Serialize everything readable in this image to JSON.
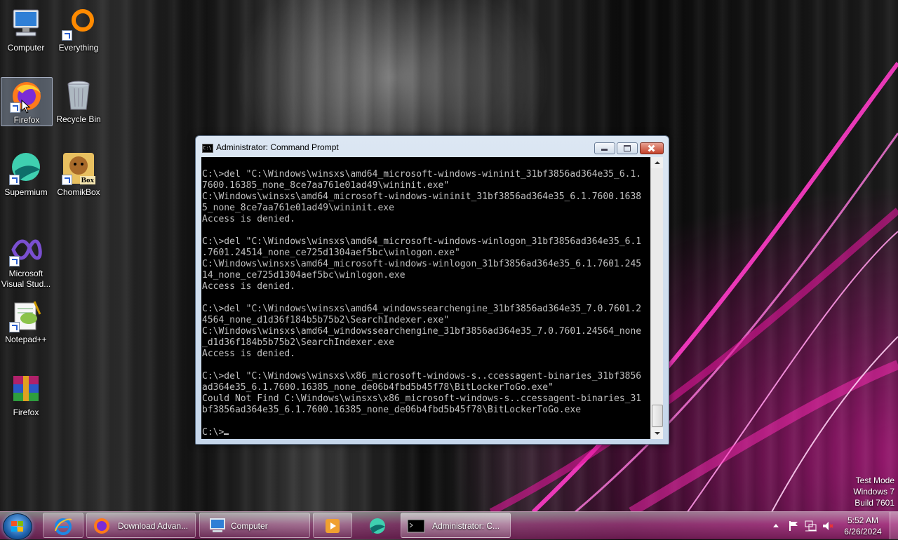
{
  "desktop": {
    "icons": [
      {
        "label": "Computer"
      },
      {
        "label": "Everything"
      },
      {
        "label": "Firefox"
      },
      {
        "label": "Recycle Bin"
      },
      {
        "label": "Supermium"
      },
      {
        "label": "ChomikBox"
      },
      {
        "label": "Microsoft Visual Stud..."
      },
      {
        "label": "Notepad++"
      },
      {
        "label": "Firefox"
      }
    ],
    "chomik_badge": "Box"
  },
  "window": {
    "title": "Administrator:  Command Prompt",
    "icon_text": "C:\\",
    "console_lines": [
      "C:\\>del \"C:\\Windows\\winsxs\\amd64_microsoft-windows-wininit_31bf3856ad364e35_6.1.",
      "7600.16385_none_8ce7aa761e01ad49\\wininit.exe\"",
      "C:\\Windows\\winsxs\\amd64_microsoft-windows-wininit_31bf3856ad364e35_6.1.7600.1638",
      "5_none_8ce7aa761e01ad49\\wininit.exe",
      "Access is denied.",
      "",
      "C:\\>del \"C:\\Windows\\winsxs\\amd64_microsoft-windows-winlogon_31bf3856ad364e35_6.1",
      ".7601.24514_none_ce725d1304aef5bc\\winlogon.exe\"",
      "C:\\Windows\\winsxs\\amd64_microsoft-windows-winlogon_31bf3856ad364e35_6.1.7601.245",
      "14_none_ce725d1304aef5bc\\winlogon.exe",
      "Access is denied.",
      "",
      "C:\\>del \"C:\\Windows\\winsxs\\amd64_windowssearchengine_31bf3856ad364e35_7.0.7601.2",
      "4564_none_d1d36f184b5b75b2\\SearchIndexer.exe\"",
      "C:\\Windows\\winsxs\\amd64_windowssearchengine_31bf3856ad364e35_7.0.7601.24564_none",
      "_d1d36f184b5b75b2\\SearchIndexer.exe",
      "Access is denied.",
      "",
      "C:\\>del \"C:\\Windows\\winsxs\\x86_microsoft-windows-s..ccessagent-binaries_31bf3856",
      "ad364e35_6.1.7600.16385_none_de06b4fbd5b45f78\\BitLockerToGo.exe\"",
      "Could Not Find C:\\Windows\\winsxs\\x86_microsoft-windows-s..ccessagent-binaries_31",
      "bf3856ad364e35_6.1.7600.16385_none_de06b4fbd5b45f78\\BitLockerToGo.exe",
      ""
    ],
    "prompt": "C:\\>"
  },
  "taskbar": {
    "tasks": [
      {
        "label": ""
      },
      {
        "label": "Download Advan..."
      },
      {
        "label": "Computer"
      },
      {
        "label": ""
      },
      {
        "label": ""
      },
      {
        "label": "Administrator:  C..."
      }
    ],
    "clock_time": "5:52 AM",
    "clock_date": "6/26/2024"
  },
  "watermark": {
    "line1": "Test Mode",
    "line2": "Windows 7",
    "line3": "Build 7601"
  },
  "colors": {
    "console_bg": "#000000",
    "console_fg": "#c0c0c0",
    "accent_pink": "#ff1fb4"
  }
}
